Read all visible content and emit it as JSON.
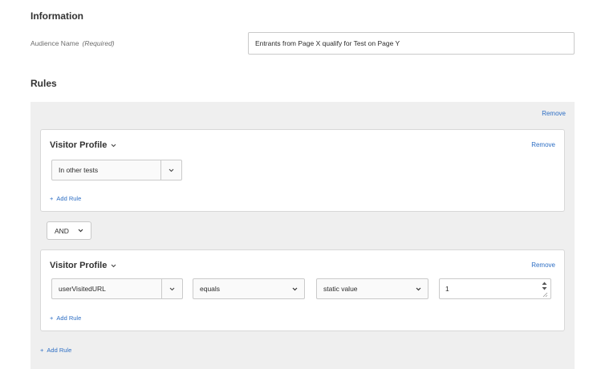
{
  "information": {
    "heading": "Information",
    "audience_name_label": "Audience Name",
    "required_label": "(Required)",
    "audience_name_value": "Entrants from Page X qualify for Test on Page Y"
  },
  "rules": {
    "heading": "Rules",
    "remove_label": "Remove",
    "add_rule_label": "Add Rule",
    "operator": "AND",
    "cards": [
      {
        "title": "Visitor Profile",
        "remove_label": "Remove",
        "attribute": "In other tests",
        "add_rule_label": "Add Rule"
      },
      {
        "title": "Visitor Profile",
        "remove_label": "Remove",
        "attribute": "userVisitedURL",
        "comparator": "equals",
        "value_type": "static value",
        "value": "1",
        "add_rule_label": "Add Rule"
      }
    ]
  },
  "colors": {
    "link": "#2d6ec4",
    "panel_bg": "#efefef",
    "border": "#cacaca"
  },
  "icons": {
    "chevron": "chevron-down-icon",
    "plus": "plus-icon",
    "spinner": "stepper-arrows-icon"
  }
}
